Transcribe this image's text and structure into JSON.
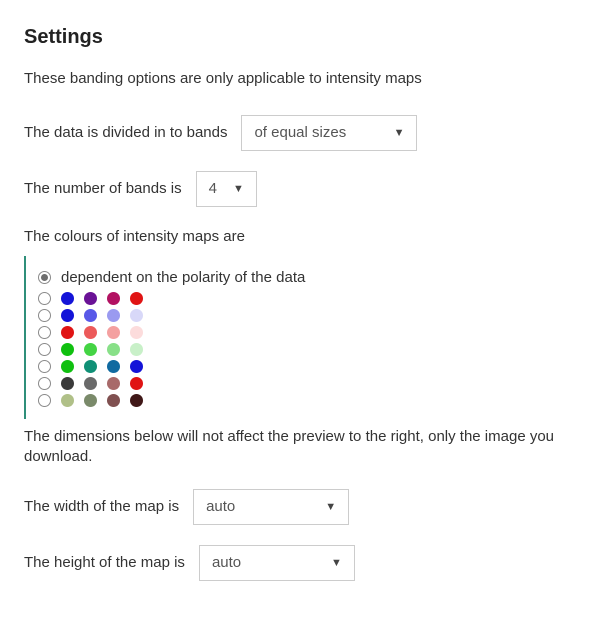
{
  "title": "Settings",
  "intro": "These banding options are only applicable to intensity maps",
  "band_mode": {
    "label": "The data is divided in to bands",
    "value": "of equal sizes"
  },
  "band_count": {
    "label": "The number of bands is",
    "value": "4"
  },
  "palette_header": "The colours of intensity maps are",
  "palettes": [
    {
      "checked": true,
      "label": "dependent on the polarity of the data",
      "swatches": []
    },
    {
      "checked": false,
      "label": "",
      "swatches": [
        "#1414d8",
        "#6a1296",
        "#b21262",
        "#e01414"
      ]
    },
    {
      "checked": false,
      "label": "",
      "swatches": [
        "#1414d8",
        "#5858e8",
        "#9a9af0",
        "#d8d8f8"
      ]
    },
    {
      "checked": false,
      "label": "",
      "swatches": [
        "#e01414",
        "#ec5a5a",
        "#f4a0a0",
        "#fcdcdc"
      ]
    },
    {
      "checked": false,
      "label": "",
      "swatches": [
        "#10c010",
        "#44d444",
        "#88e088",
        "#c8f0c8"
      ]
    },
    {
      "checked": false,
      "label": "",
      "swatches": [
        "#10c010",
        "#109076",
        "#106aa0",
        "#1414d8"
      ]
    },
    {
      "checked": false,
      "label": "",
      "swatches": [
        "#3a3a3a",
        "#6a6a6a",
        "#a86a6a",
        "#e01414"
      ]
    },
    {
      "checked": false,
      "label": "",
      "swatches": [
        "#b0c088",
        "#7a8a6a",
        "#805050",
        "#401818"
      ]
    }
  ],
  "note": "The dimensions below will not affect the preview to the right, only the image you download.",
  "width": {
    "label": "The width of the map is",
    "value": "auto"
  },
  "height": {
    "label": "The height of the map is",
    "value": "auto"
  }
}
